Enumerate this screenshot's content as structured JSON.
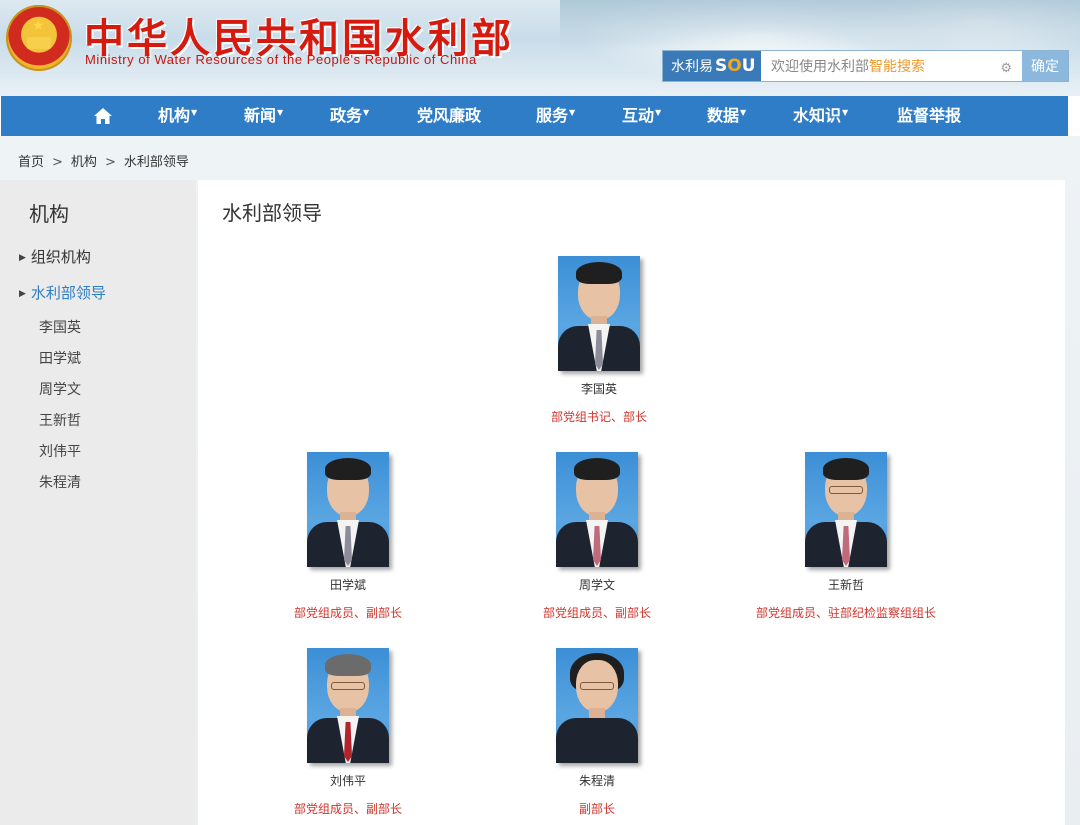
{
  "header": {
    "title_cn": "中华人民共和国水利部",
    "title_en": "Ministry of Water Resources of the People's Republic of China",
    "search": {
      "brand_label": "水利易",
      "brand_sou": "SOU",
      "placeholder_prefix": "欢迎使用水利部",
      "placeholder_highlight": "智能搜索",
      "submit_label": "确定"
    }
  },
  "nav": {
    "items": [
      {
        "label": "机构",
        "has_dropdown": true
      },
      {
        "label": "新闻",
        "has_dropdown": true
      },
      {
        "label": "政务",
        "has_dropdown": true
      },
      {
        "label": "党风廉政",
        "has_dropdown": false
      },
      {
        "label": "服务",
        "has_dropdown": true
      },
      {
        "label": "互动",
        "has_dropdown": true
      },
      {
        "label": "数据",
        "has_dropdown": true
      },
      {
        "label": "水知识",
        "has_dropdown": true
      },
      {
        "label": "监督举报",
        "has_dropdown": false
      }
    ]
  },
  "breadcrumb": {
    "items": [
      "首页",
      "机构",
      "水利部领导"
    ],
    "separator": ">"
  },
  "sidebar": {
    "title": "机构",
    "sections": [
      {
        "label": "组织机构",
        "active": false
      },
      {
        "label": "水利部领导",
        "active": true
      }
    ],
    "sub_items": [
      "李国英",
      "田学斌",
      "周学文",
      "王新哲",
      "刘伟平",
      "朱程清"
    ]
  },
  "main": {
    "title": "水利部领导",
    "leaders": [
      {
        "name": "李国英",
        "role": "部党组书记、部长"
      },
      {
        "name": "田学斌",
        "role": "部党组成员、副部长"
      },
      {
        "name": "周学文",
        "role": "部党组成员、副部长"
      },
      {
        "name": "王新哲",
        "role": "部党组成员、驻部纪检监察组组长"
      },
      {
        "name": "刘伟平",
        "role": "部党组成员、副部长"
      },
      {
        "name": "朱程清",
        "role": "副部长"
      }
    ]
  },
  "colors": {
    "nav_bg": "#2f7dc7",
    "title_red": "#d51a10",
    "role_red": "#d0342c",
    "active_link": "#2f7dc7",
    "sidebar_bg": "#ebebeb"
  }
}
